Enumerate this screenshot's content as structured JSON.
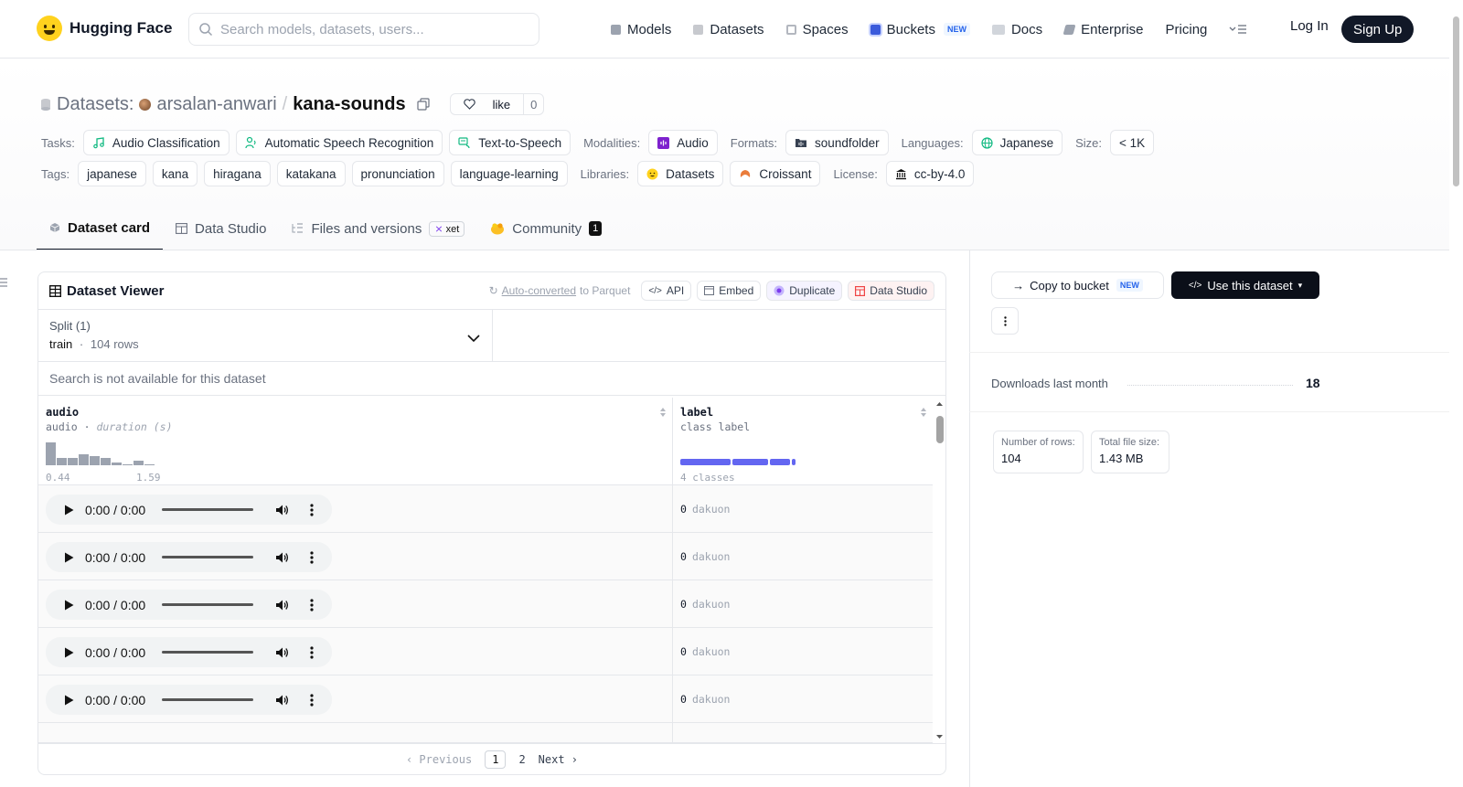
{
  "header": {
    "brand": "Hugging Face",
    "search_placeholder": "Search models, datasets, users...",
    "nav": [
      {
        "label": "Models",
        "icon": "cube-icon"
      },
      {
        "label": "Datasets",
        "icon": "database-icon"
      },
      {
        "label": "Spaces",
        "icon": "grid-icon"
      },
      {
        "label": "Buckets",
        "icon": "bucket-icon"
      },
      {
        "label": "Docs",
        "icon": "book-icon"
      },
      {
        "label": "Enterprise",
        "icon": "pencil-icon"
      },
      {
        "label": "Pricing"
      }
    ],
    "new_badge": "NEW",
    "login": "Log In",
    "signup": "Sign Up"
  },
  "dataset": {
    "section": "Datasets:",
    "owner": "arsalan-anwari",
    "slash": "/",
    "name": "kana-sounds",
    "like_label": "like",
    "like_count": "0"
  },
  "meta": {
    "tasks_label": "Tasks:",
    "tasks": [
      "Audio Classification",
      "Automatic Speech Recognition",
      "Text-to-Speech"
    ],
    "modalities_label": "Modalities:",
    "modalities": [
      "Audio"
    ],
    "formats_label": "Formats:",
    "formats": [
      "soundfolder"
    ],
    "languages_label": "Languages:",
    "languages": [
      "Japanese"
    ],
    "size_label": "Size:",
    "size": "< 1K",
    "tags_label": "Tags:",
    "tags": [
      "japanese",
      "kana",
      "hiragana",
      "katakana",
      "pronunciation",
      "language-learning"
    ],
    "libraries_label": "Libraries:",
    "libraries": [
      "Datasets",
      "Croissant"
    ],
    "license_label": "License:",
    "license": "cc-by-4.0"
  },
  "tabs": [
    {
      "label": "Dataset card"
    },
    {
      "label": "Data Studio"
    },
    {
      "label": "Files and versions",
      "badge": "xet"
    },
    {
      "label": "Community",
      "badge": "1"
    }
  ],
  "viewer": {
    "title": "Dataset Viewer",
    "auto_converted": "Auto-converted",
    "to_parquet": "to Parquet",
    "tools": [
      "API",
      "Embed",
      "Duplicate",
      "Data Studio"
    ],
    "split_label": "Split (1)",
    "split_name": "train",
    "split_sep": "·",
    "split_rows": "104 rows",
    "search_na": "Search is not available for this dataset",
    "columns": [
      {
        "name": "audio",
        "type": "audio",
        "sub": "duration (s)",
        "min": "0.44",
        "max": "1.59",
        "sep": "·"
      },
      {
        "name": "label",
        "type": "class label",
        "classes": "4 classes"
      }
    ],
    "histogram": [
      0.95,
      0.3,
      0.3,
      0.45,
      0.4,
      0.3,
      0.1,
      0.05,
      0.2,
      0.05
    ],
    "class_bar": [
      0.42,
      0.3,
      0.17,
      0.03
    ],
    "rows": [
      {
        "time": "0:00 / 0:00",
        "label_id": "0",
        "label_name": "dakuon"
      },
      {
        "time": "0:00 / 0:00",
        "label_id": "0",
        "label_name": "dakuon"
      },
      {
        "time": "0:00 / 0:00",
        "label_id": "0",
        "label_name": "dakuon"
      },
      {
        "time": "0:00 / 0:00",
        "label_id": "0",
        "label_name": "dakuon"
      },
      {
        "time": "0:00 / 0:00",
        "label_id": "0",
        "label_name": "dakuon"
      }
    ],
    "pager": {
      "prev": "Previous",
      "pages": [
        "1",
        "2"
      ],
      "next": "Next"
    }
  },
  "sidebar": {
    "copy_bucket": "Copy to bucket",
    "use_dataset": "Use this dataset",
    "downloads_label": "Downloads last month",
    "downloads_value": "18",
    "rows_label": "Number of rows:",
    "rows_value": "104",
    "size_label": "Total file size:",
    "size_value": "1.43 MB"
  }
}
